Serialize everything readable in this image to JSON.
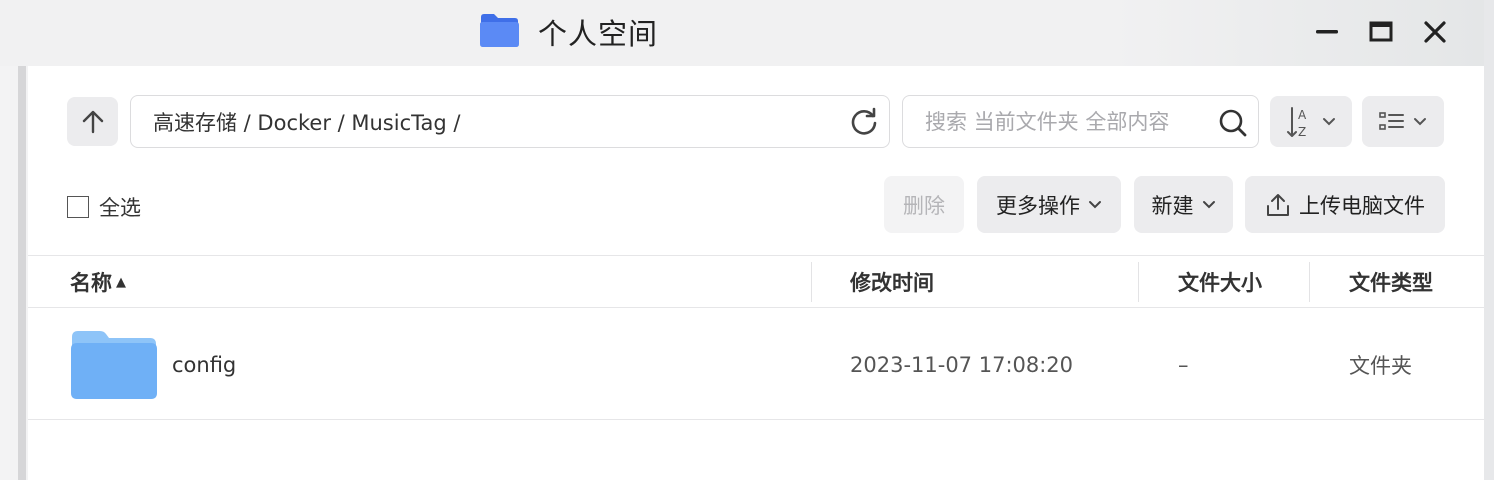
{
  "window": {
    "title": "个人空间",
    "icon": "folder-icon",
    "controls": [
      "minimize-icon",
      "maximize-icon",
      "close-icon"
    ]
  },
  "toolbar": {
    "path": "高速存储 / Docker / MusicTag /",
    "search_placeholder": "搜索 当前文件夹 全部内容"
  },
  "actions": {
    "select_all": "全选",
    "delete": "删除",
    "more": "更多操作",
    "new": "新建",
    "upload": "上传电脑文件"
  },
  "table": {
    "columns": [
      "名称",
      "修改时间",
      "文件大小",
      "文件类型"
    ],
    "sort_indicator": "▲",
    "rows": [
      {
        "name": "config",
        "modified": "2023-11-07 17:08:20",
        "size": "–",
        "type": "文件夹"
      }
    ]
  },
  "colors": {
    "folder_blue": "#5b8af5",
    "folder_light": "#7bb8f7"
  }
}
